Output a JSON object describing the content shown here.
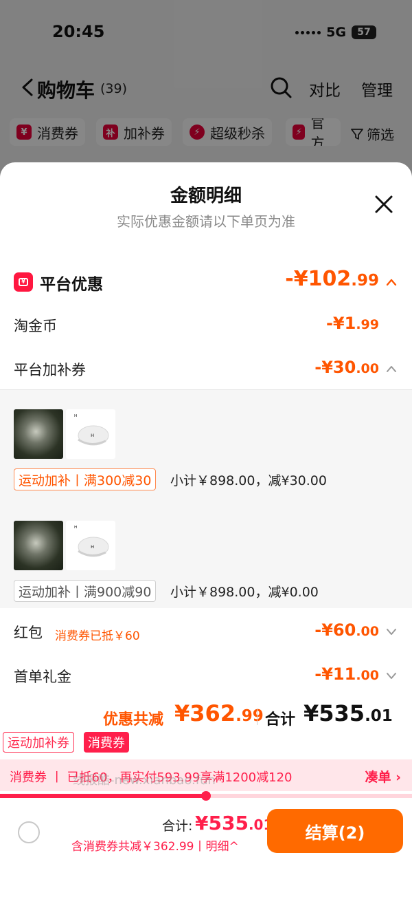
{
  "status": {
    "time": "20:45",
    "network": "5G",
    "battery": "57"
  },
  "cart": {
    "title": "购物车",
    "count": "(39)",
    "compare_label": "对比",
    "manage_label": "管理",
    "filters": [
      "消费券",
      "加补券",
      "超级秒杀",
      "官方"
    ],
    "filter_btn": "筛选"
  },
  "sheet": {
    "title": "金额明细",
    "subtitle": "实际优惠金额请以下单页为准",
    "platform": {
      "label": "平台优惠",
      "amount_int": "-¥102",
      "amount_dec": ".99"
    },
    "gold_coin": {
      "label": "淘金币",
      "amount_int": "-¥1",
      "amount_dec": ".99"
    },
    "subsidy": {
      "label": "平台加补券",
      "amount_int": "-¥30",
      "amount_dec": ".00"
    },
    "subsidy_groups": [
      {
        "tag": "运动加补丨满300减30",
        "subtotal": "小计￥898.00，减¥30.00",
        "thumb_logo": "ᴴ"
      },
      {
        "tag": "运动加补丨满900减90",
        "subtotal": "小计￥898.00，减¥0.00",
        "thumb_logo": "ᴴ"
      }
    ],
    "red_packet": {
      "label": "红包",
      "note": "消费券已抵￥60",
      "amount_int": "-¥60",
      "amount_dec": ".00"
    },
    "first_order": {
      "label": "首单礼金",
      "amount_int": "-¥11",
      "amount_dec": ".00"
    },
    "totals": {
      "discount_label": "优惠共减",
      "discount_int": "¥362",
      "discount_dec": ".99",
      "total_label": "合计",
      "total_int": "¥535",
      "total_dec": ".01"
    }
  },
  "bottom": {
    "tag_a": "运动加补券",
    "tag_b": "消费券",
    "promo_text": "消费券 丨 已抵60，再实付593.99享满1200减120",
    "promo_cta": "凑单 ›",
    "watermark": "线报酷-new.xianbao.fun",
    "progress": 0.5,
    "sum_label": "合计:",
    "sum_int": "¥535",
    "sum_dec": ".01",
    "sum_detail": "含消费券共减￥362.99丨明细^",
    "checkout_label": "结算(2)"
  },
  "colors": {
    "accent_orange": "#ff5500",
    "accent_red": "#ff1f4b",
    "checkout_orange": "#ff6a00"
  }
}
